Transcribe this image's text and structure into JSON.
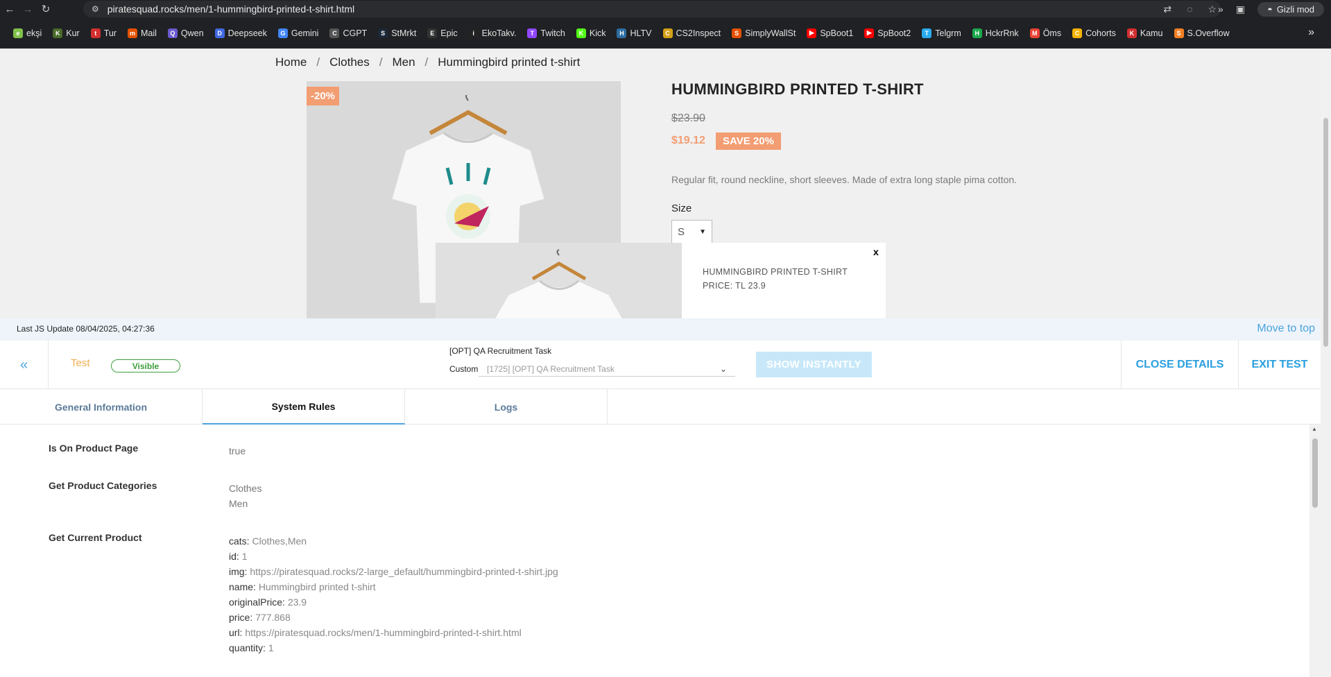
{
  "browser": {
    "url": "piratesquad.rocks/men/1-hummingbird-printed-t-shirt.html",
    "incognito_label": "Gizli mod",
    "bookmarks": [
      {
        "label": "ekşi",
        "color": "#81c14b",
        "glyph": "e"
      },
      {
        "label": "Kur",
        "color": "#4a6a2a",
        "glyph": "K"
      },
      {
        "label": "Tur",
        "color": "#d32f2f",
        "glyph": "t"
      },
      {
        "label": "Mail",
        "color": "#e65100",
        "glyph": "m"
      },
      {
        "label": "Qwen",
        "color": "#6a5acd",
        "glyph": "Q"
      },
      {
        "label": "Deepseek",
        "color": "#4169e1",
        "glyph": "D"
      },
      {
        "label": "Gemini",
        "color": "#4285f4",
        "glyph": "G"
      },
      {
        "label": "CGPT",
        "color": "#555555",
        "glyph": "C"
      },
      {
        "label": "StMrkt",
        "color": "#1b2838",
        "glyph": "S"
      },
      {
        "label": "Epic",
        "color": "#333333",
        "glyph": "E"
      },
      {
        "label": "EkoTakv.",
        "color": "#222222",
        "glyph": "i"
      },
      {
        "label": "Twitch",
        "color": "#9146ff",
        "glyph": "T"
      },
      {
        "label": "Kick",
        "color": "#53fc18",
        "glyph": "K"
      },
      {
        "label": "HLTV",
        "color": "#2d6da3",
        "glyph": "H"
      },
      {
        "label": "CS2Inspect",
        "color": "#d4a017",
        "glyph": "C"
      },
      {
        "label": "SimplyWallSt",
        "color": "#e65100",
        "glyph": "S"
      },
      {
        "label": "SpBoot1",
        "color": "#ff0000",
        "glyph": "▶"
      },
      {
        "label": "SpBoot2",
        "color": "#ff0000",
        "glyph": "▶"
      },
      {
        "label": "Telgrm",
        "color": "#2aabee",
        "glyph": "T"
      },
      {
        "label": "HckrRnk",
        "color": "#1ba94c",
        "glyph": "H"
      },
      {
        "label": "Öms",
        "color": "#ea4335",
        "glyph": "M"
      },
      {
        "label": "Cohorts",
        "color": "#f4b400",
        "glyph": "C"
      },
      {
        "label": "Kamu",
        "color": "#d32f2f",
        "glyph": "K"
      },
      {
        "label": "S.Overflow",
        "color": "#f48024",
        "glyph": "S"
      }
    ]
  },
  "shop": {
    "breadcrumb": [
      "Home",
      "Clothes",
      "Men",
      "Hummingbird printed t-shirt"
    ],
    "discount_flag": "-20%",
    "title": "HUMMINGBIRD PRINTED T-SHIRT",
    "old_price": "$23.90",
    "new_price": "$19.12",
    "save_badge": "SAVE 20%",
    "description": "Regular fit, round neckline, short sleeves. Made of extra long staple pima cotton.",
    "size_label": "Size",
    "size_value": "S",
    "accent_color": "#f39d72"
  },
  "popup": {
    "close": "x",
    "title": "HUMMINGBIRD PRINTED T-SHIRT",
    "price": "PRICE: TL 23.9"
  },
  "panel": {
    "last_update": "Last JS Update 08/04/2025, 04:27:36",
    "move_top": "Move to top",
    "back": "«",
    "test_label": "Test",
    "visible_badge": "Visible",
    "campaign_name": "[OPT] QA Recruitment Task",
    "custom_label": "Custom",
    "custom_select": "[1725] [OPT] QA Recruitment Task",
    "show_instantly": "SHOW INSTANTLY",
    "close_details": "CLOSE DETAILS",
    "exit_test": "EXIT TEST",
    "tabs": [
      "General Information",
      "System Rules",
      "Logs"
    ],
    "active_tab": "System Rules",
    "rules": {
      "r1_label": "Is On Product Page",
      "r1_value": "true",
      "r2_label": "Get Product Categories",
      "r2_values": [
        "Clothes",
        "Men"
      ],
      "r3_label": "Get Current Product",
      "r3_fields": [
        {
          "k": "cats:",
          "v": "Clothes,Men"
        },
        {
          "k": "id:",
          "v": "1"
        },
        {
          "k": "img:",
          "v": "https://piratesquad.rocks/2-large_default/hummingbird-printed-t-shirt.jpg"
        },
        {
          "k": "name:",
          "v": "Hummingbird printed t-shirt"
        },
        {
          "k": "originalPrice:",
          "v": "23.9"
        },
        {
          "k": "price:",
          "v": "777.868"
        },
        {
          "k": "url:",
          "v": "https://piratesquad.rocks/men/1-hummingbird-printed-t-shirt.html"
        },
        {
          "k": "quantity:",
          "v": "1"
        }
      ]
    }
  }
}
